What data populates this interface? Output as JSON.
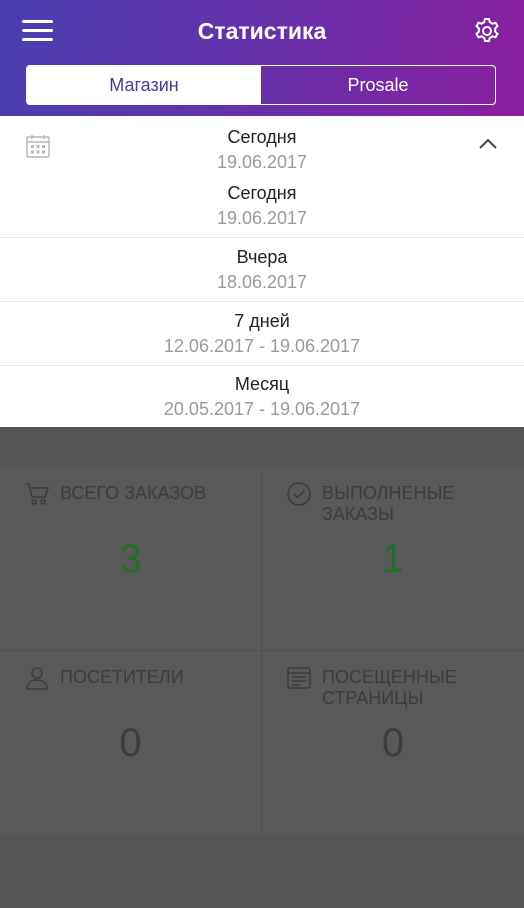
{
  "header": {
    "title": "Статистика",
    "menu_icon": "hamburger-menu-icon",
    "settings_icon": "gear-icon",
    "gradient_colors": [
      "#4a3fb0",
      "#8a1fa0"
    ]
  },
  "tabs": [
    {
      "label": "Магазин",
      "active": true
    },
    {
      "label": "Prosale",
      "active": false
    }
  ],
  "period": {
    "selected_label": "Сегодня",
    "selected_date": "19.06.2017",
    "calendar_icon": "calendar-icon",
    "collapse_icon": "chevron-up-icon",
    "options": [
      {
        "label": "Сегодня",
        "date": "19.06.2017"
      },
      {
        "label": "Вчера",
        "date": "18.06.2017"
      },
      {
        "label": "7 дней",
        "date": "12.06.2017 - 19.06.2017"
      },
      {
        "label": "Месяц",
        "date": "20.05.2017 - 19.06.2017"
      }
    ]
  },
  "stats": [
    {
      "caption": "Всего заказов",
      "value": "3",
      "icon": "cart-icon",
      "color": "#1f6e2b"
    },
    {
      "caption": "Выполненые заказы",
      "value": "1",
      "icon": "check-circle-icon",
      "color": "#1f6e2b"
    },
    {
      "caption": "Посетители",
      "value": "0",
      "icon": "user-icon",
      "color": "#3d3d3d"
    },
    {
      "caption": "Посещенные страницы",
      "value": "0",
      "icon": "pages-icon",
      "color": "#3d3d3d"
    }
  ]
}
